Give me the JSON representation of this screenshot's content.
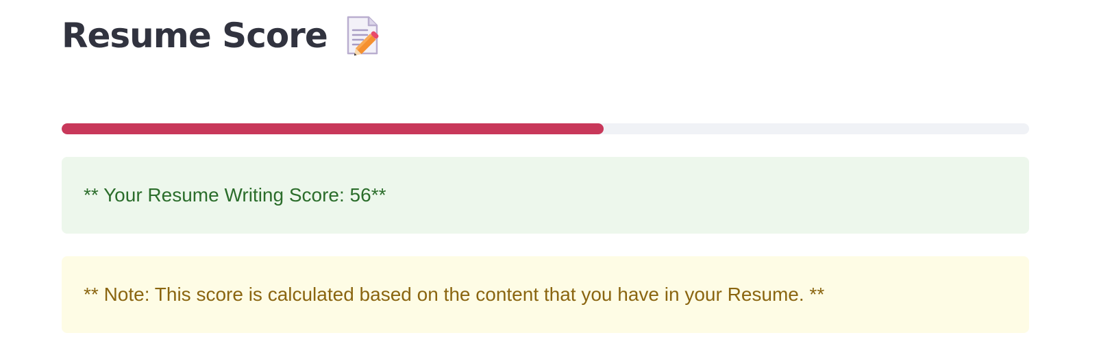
{
  "header": {
    "title": "Resume Score",
    "icon": "memo-pencil-icon"
  },
  "progress": {
    "value": 56,
    "max": 100,
    "fill_color": "#c8385a",
    "track_color": "#f0f2f6"
  },
  "alerts": {
    "score_message": "** Your Resume Writing Score: 56**",
    "note_message": "** Note: This score is calculated based on the content that you have in your Resume. **"
  },
  "colors": {
    "success_bg": "#edf7ec",
    "success_text": "#2b6d2b",
    "warning_bg": "#fefce5",
    "warning_text": "#8a6510",
    "title_text": "#31333f"
  }
}
